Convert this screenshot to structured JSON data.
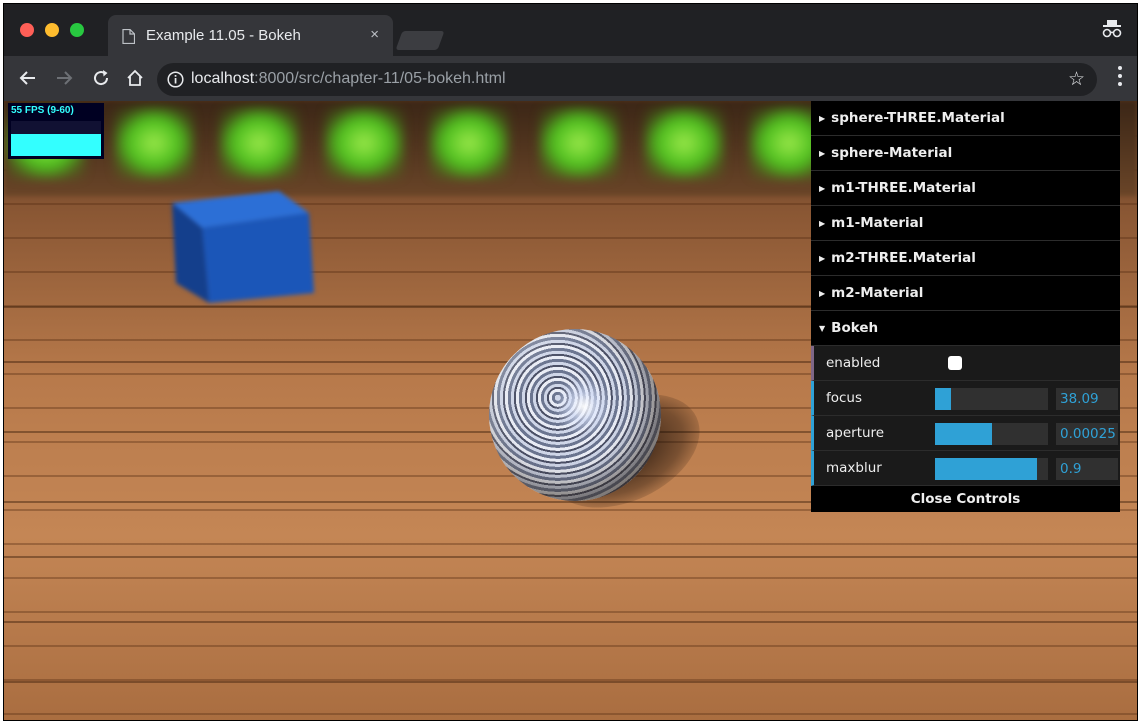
{
  "tab": {
    "title": "Example 11.05 - Bokeh",
    "close_glyph": "×"
  },
  "toolbar": {
    "url_host": "localhost",
    "url_path": ":8000/src/chapter-11/05-bokeh.html",
    "bookmark_glyph": "☆"
  },
  "stats": {
    "label": "55 FPS (9-60)"
  },
  "gui": {
    "folders": [
      {
        "label": "sphere-THREE.Material",
        "expanded": false
      },
      {
        "label": "sphere-Material",
        "expanded": false
      },
      {
        "label": "m1-THREE.Material",
        "expanded": false
      },
      {
        "label": "m1-Material",
        "expanded": false
      },
      {
        "label": "m2-THREE.Material",
        "expanded": false
      },
      {
        "label": "m2-Material",
        "expanded": false
      },
      {
        "label": "Bokeh",
        "expanded": true
      }
    ],
    "bokeh": {
      "enabled": {
        "label": "enabled",
        "checked": false
      },
      "focus": {
        "label": "focus",
        "value": "38.09",
        "fill": 0.14
      },
      "aperture": {
        "label": "aperture",
        "value": "0.00025",
        "fill": 0.5
      },
      "maxblur": {
        "label": "maxblur",
        "value": "0.9",
        "fill": 0.9
      }
    },
    "close_label": "Close Controls"
  },
  "colors": {
    "gui_accent": "#2fa1d6",
    "stats_color": "#33ffff",
    "cube_blue": "#1b56b8"
  }
}
